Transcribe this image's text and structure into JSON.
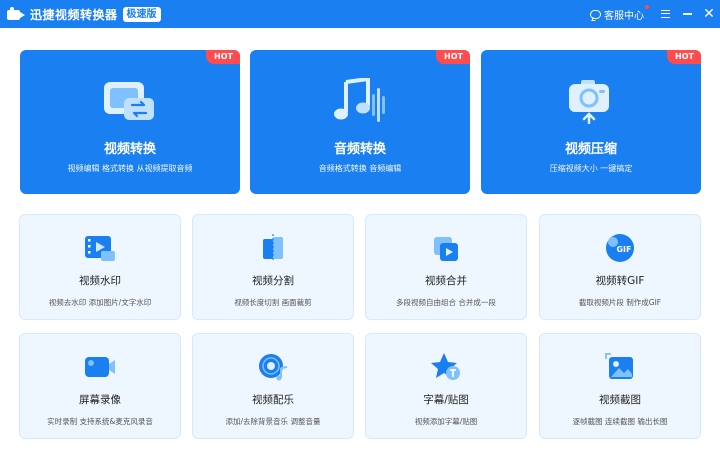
{
  "app": {
    "title": "迅捷视频转换器",
    "edition": "极速版",
    "support_label": "客服中心"
  },
  "hot_label": "HOT",
  "big_cards": [
    {
      "title": "视频转换",
      "subtitle": "视频编辑 格式转换 从视频提取音频",
      "icon": "video-convert-icon"
    },
    {
      "title": "音频转换",
      "subtitle": "音频格式转换 音频编辑",
      "icon": "audio-convert-icon"
    },
    {
      "title": "视频压缩",
      "subtitle": "压缩视频大小 一键搞定",
      "icon": "video-compress-icon"
    }
  ],
  "small_cards": [
    {
      "title": "视频水印",
      "subtitle": "视频去水印 添加图片/文字水印",
      "icon": "watermark-icon"
    },
    {
      "title": "视频分割",
      "subtitle": "视频长度切割 画面裁剪",
      "icon": "split-icon"
    },
    {
      "title": "视频合并",
      "subtitle": "多段视频自由组合 合并成一段",
      "icon": "merge-icon"
    },
    {
      "title": "视频转GIF",
      "subtitle": "截取视频片段 制作成GIF",
      "icon": "gif-icon"
    },
    {
      "title": "屏幕录像",
      "subtitle": "实时录制 支持系统&麦克风录音",
      "icon": "screen-record-icon"
    },
    {
      "title": "视频配乐",
      "subtitle": "添加/去除背景音乐 调整音量",
      "icon": "music-icon"
    },
    {
      "title": "字幕/贴图",
      "subtitle": "视频添加字幕/贴图",
      "icon": "subtitle-icon"
    },
    {
      "title": "视频截图",
      "subtitle": "逐帧截图 连续截图 输出长图",
      "icon": "screenshot-icon"
    }
  ],
  "gif_icon_text": "GIF",
  "colors": {
    "primary": "#1a7ff0",
    "hot": "#ff4d4f",
    "card_bg": "#eef6ff"
  }
}
